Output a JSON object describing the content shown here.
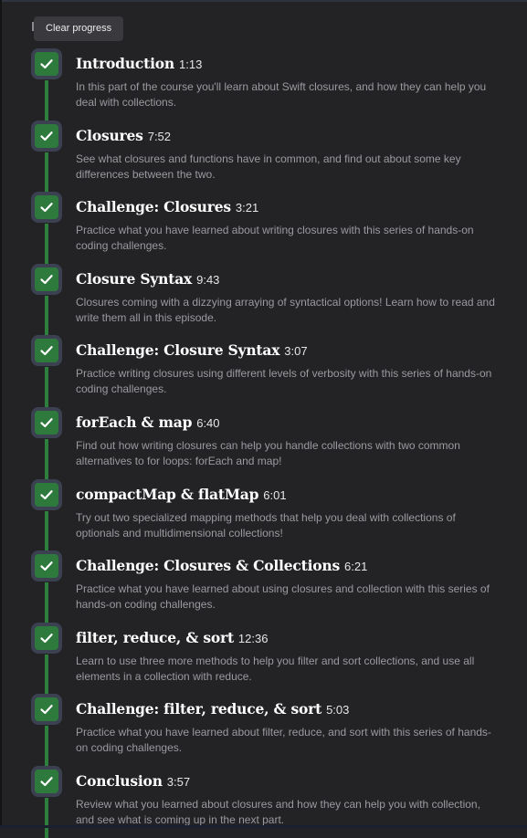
{
  "tooltip": {
    "label": "Clear progress"
  },
  "colors": {
    "background": "#232326",
    "checkbox_fill": "#2d7a3c",
    "connector": "#2e7e3e",
    "title": "#ffffff",
    "description": "#9a9aa0"
  },
  "lessons": [
    {
      "title": "Introduction",
      "duration": "1:13",
      "description": "In this part of the course you'll learn about Swift closures, and how they can help you deal with collections.",
      "completed": true
    },
    {
      "title": "Closures",
      "duration": "7:52",
      "description": "See what closures and functions have in common, and find out about some key differences between the two.",
      "completed": true
    },
    {
      "title": "Challenge: Closures",
      "duration": "3:21",
      "description": "Practice what you have learned about writing closures with this series of hands-on coding challenges.",
      "completed": true
    },
    {
      "title": "Closure Syntax",
      "duration": "9:43",
      "description": "Closures coming with a dizzying arraying of syntactical options! Learn how to read and write them all in this episode.",
      "completed": true
    },
    {
      "title": "Challenge: Closure Syntax",
      "duration": "3:07",
      "description": "Practice writing closures using different levels of verbosity with this series of hands-on coding challenges.",
      "completed": true
    },
    {
      "title": "forEach & map",
      "duration": "6:40",
      "description": "Find out how writing closures can help you handle collections with two common alternatives to for loops: forEach and map!",
      "completed": true
    },
    {
      "title": "compactMap & flatMap",
      "duration": "6:01",
      "description": "Try out two specialized mapping methods that help you deal with collections of optionals and multidimensional collections!",
      "completed": true
    },
    {
      "title": "Challenge: Closures & Collections",
      "duration": "6:21",
      "description": "Practice what you have learned about using closures and collection with this series of hands-on coding challenges.",
      "completed": true
    },
    {
      "title": "filter, reduce, & sort",
      "duration": "12:36",
      "description": "Learn to use three more methods to help you filter and sort collections, and use all elements in a collection with reduce.",
      "completed": true
    },
    {
      "title": "Challenge: filter, reduce, & sort",
      "duration": "5:03",
      "description": "Practice what you have learned about filter, reduce, and sort with this series of hands-on coding challenges.",
      "completed": true
    },
    {
      "title": "Conclusion",
      "duration": "3:57",
      "description": "Review what you learned about closures and how they can help you with collection, and see what is coming up in the next part.",
      "completed": true
    }
  ]
}
